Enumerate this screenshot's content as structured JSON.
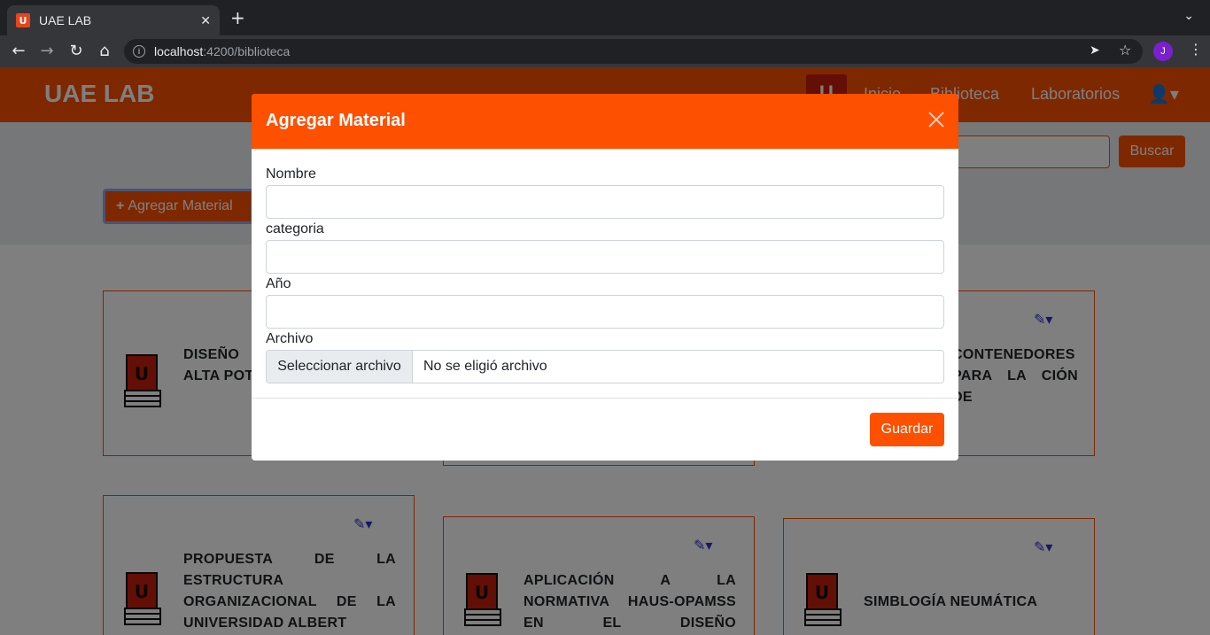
{
  "browser": {
    "tab_title": "UAE LAB",
    "tab_favicon": "U",
    "new_tab_glyph": "+",
    "close_glyph": "✕",
    "url_host": "localhost",
    "url_path": ":4200/biblioteca",
    "profile_initial": "J"
  },
  "navbar": {
    "brand": "UAE LAB",
    "logo_glyph": "U",
    "links": [
      "Inicio",
      "Biblioteca",
      "Laboratorios"
    ]
  },
  "toolbar": {
    "add_label": "Agregar Material",
    "search_label": "Buscar"
  },
  "cards": [
    {
      "title": "DISEÑO CICLO DE IMANES ALTA POTENCIA"
    },
    {
      "title": "CONTENEDORES PARA LA CIÓN DE"
    },
    {
      "title": "PROPUESTA DE LA ESTRUCTURA ORGANIZACIONAL DE LA UNIVERSIDAD ALBERT"
    },
    {
      "title": "APLICACIÓN A LA NORMATIVA HAUS-OPAMSS EN EL DISEÑO ARQUITECTONICO"
    },
    {
      "title": "SIMBLOGÍA NEUMÁTICA"
    }
  ],
  "modal": {
    "title": "Agregar Material",
    "fields": {
      "nombre_label": "Nombre",
      "categoria_label": "categoria",
      "anio_label": "Año",
      "archivo_label": "Archivo",
      "nombre_value": "",
      "categoria_value": "",
      "anio_value": ""
    },
    "file_button": "Seleccionar archivo",
    "file_status": "No se eligió archivo",
    "save_label": "Guardar"
  },
  "colors": {
    "brand_orange": "#fd5000",
    "logo_red": "#c81e0a",
    "edit_blue": "#3030c8"
  }
}
